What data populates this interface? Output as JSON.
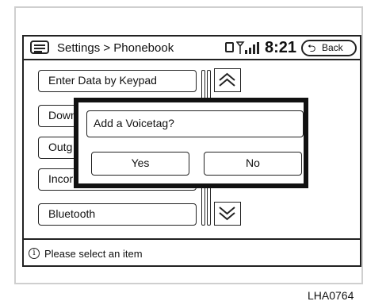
{
  "header": {
    "keyboard_icon": "keyboard-icon",
    "title": "Settings > Phonebook",
    "phone_icon": "phone-icon",
    "signal_icon": "signal-strength-icon",
    "time": "8:21",
    "back_label": "Back"
  },
  "list": {
    "items": [
      {
        "label": "Enter Data by Keypad"
      },
      {
        "label": "Down"
      },
      {
        "label": "Outg"
      },
      {
        "label": "Incor"
      },
      {
        "label": "Bluetooth"
      }
    ]
  },
  "scrollbar": {
    "up_icon": "chevron-up-icon",
    "down_icon": "chevron-down-icon"
  },
  "dialog": {
    "message": "Add a Voicetag?",
    "yes_label": "Yes",
    "no_label": "No"
  },
  "status": {
    "icon": "info-icon",
    "text": "Please select an item"
  },
  "figure_code": "LHA0764"
}
